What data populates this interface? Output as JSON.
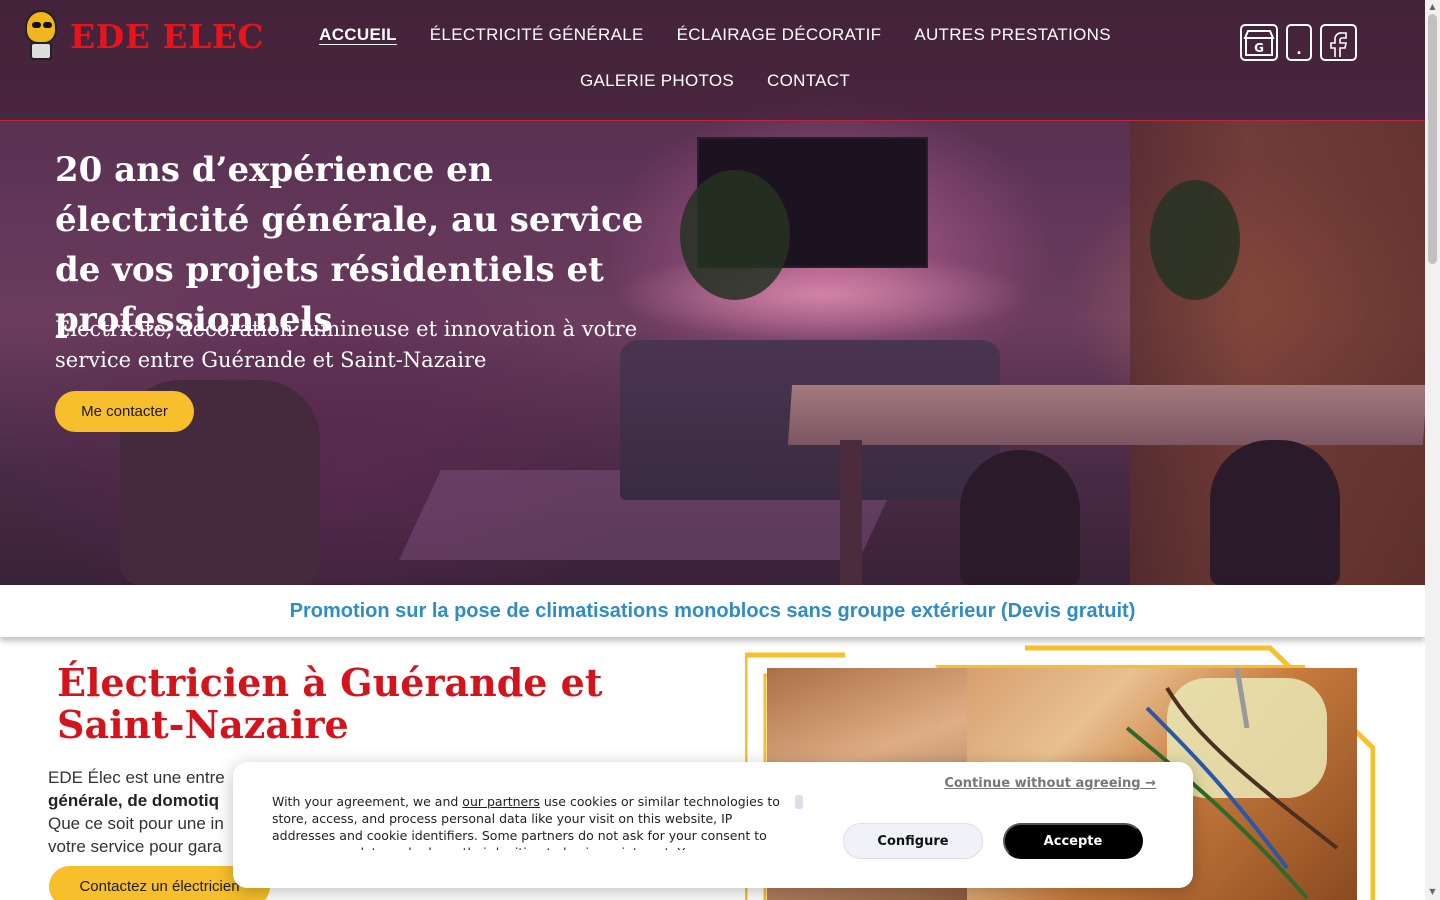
{
  "brand": {
    "name": "EDE ELEC"
  },
  "nav": {
    "row1": [
      "ACCUEIL",
      "ÉLECTRICITÉ GÉNÉRALE",
      "ÉCLAIRAGE DÉCORATIF",
      "AUTRES PRESTATIONS"
    ],
    "row2": [
      "GALERIE PHOTOS",
      "CONTACT"
    ],
    "active": "ACCUEIL"
  },
  "social": {
    "google_label": "G",
    "phone_label": "."
  },
  "hero": {
    "title": "20 ans d’expérience en électricité générale, au service de vos projets résidentiels et professionnels",
    "subtitle": "Électricité, décoration lumineuse et innovation à votre service entre Guérande et Saint-Nazaire",
    "cta": "Me contacter"
  },
  "promo": {
    "text": "Promotion sur la pose de climatisations monoblocs sans groupe extérieur (Devis gratuit)"
  },
  "section": {
    "title": "Électricien à Guérande et Saint-Nazaire",
    "line1": "EDE Élec est une entre",
    "line2_bold": "générale, de domotiq",
    "line3": "Que ce soit pour une in",
    "line4": "votre service pour gara",
    "cta": "Contactez un électricien"
  },
  "cookie": {
    "text_before_link": "With your agreement, we and ",
    "link": "our partners",
    "text_after_link": " use cookies or similar technologies to store, access, and process personal data like your visit on this website, IP addresses and cookie identifiers. Some partners do not ask for your consent to process your data and rely on their legitimate business interest. You can",
    "continue": "Continue without agreeing →",
    "configure": "Configure",
    "accept": "Accepte"
  },
  "colors": {
    "brand_red": "#e8141c",
    "promo_blue": "#2f8cc6",
    "button_yellow": "#f6bf2b",
    "section_title_red": "#d4141c"
  }
}
